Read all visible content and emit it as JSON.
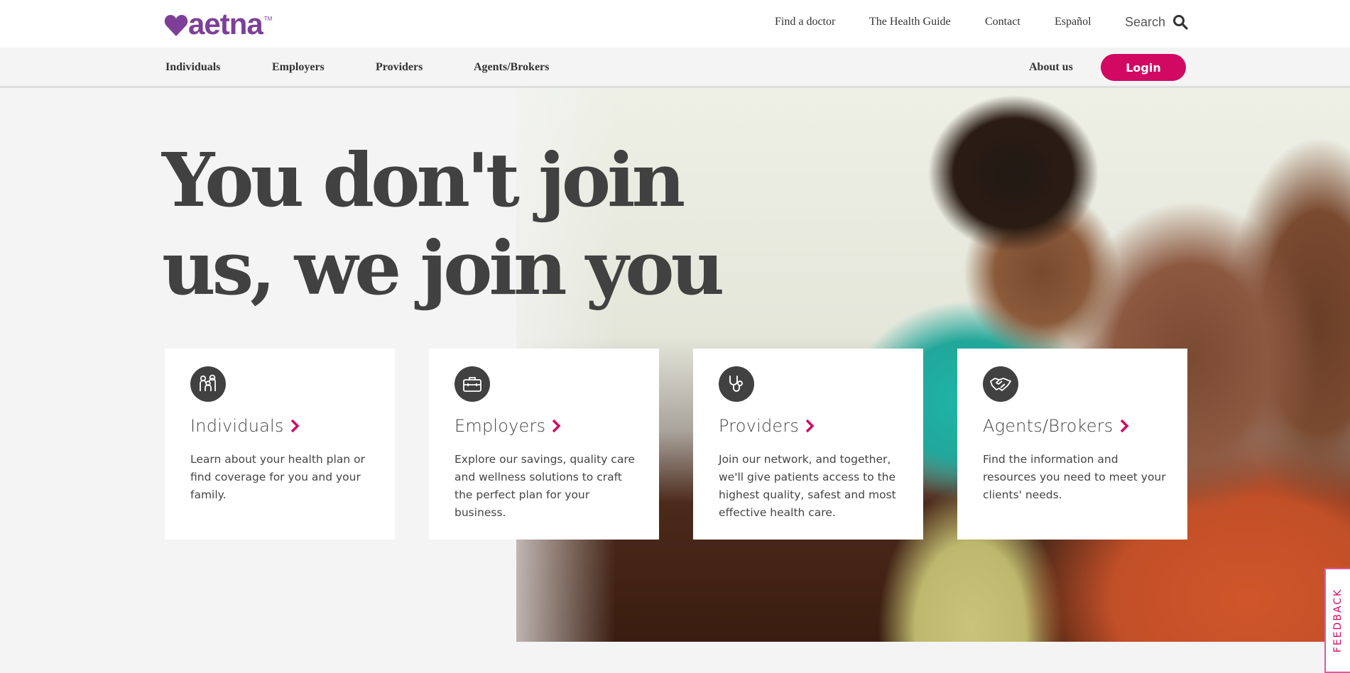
{
  "brand": {
    "name": "aetna",
    "trademark": "TM",
    "logo_icon": "heart-icon",
    "colors": {
      "purple": "#7d3f98",
      "magenta": "#d20962",
      "text_dark": "#414141"
    }
  },
  "utility_nav": {
    "items": [
      {
        "label": "Find a doctor"
      },
      {
        "label": "The Health Guide"
      },
      {
        "label": "Contact"
      },
      {
        "label": "Español"
      }
    ],
    "search": {
      "label": "Search",
      "icon": "search-icon"
    }
  },
  "main_nav": {
    "items": [
      {
        "label": "Individuals"
      },
      {
        "label": "Employers"
      },
      {
        "label": "Providers"
      },
      {
        "label": "Agents/Brokers"
      }
    ],
    "about_label": "About us",
    "login_label": "Login"
  },
  "hero": {
    "headline_line1": "You don't join",
    "headline_line2": "us, we join you",
    "image_alt": "Family with baby, grandmother and father smiling"
  },
  "cards": [
    {
      "icon": "family-icon",
      "title": "Individuals",
      "description": "Learn about your health plan or find coverage for you and your family."
    },
    {
      "icon": "briefcase-icon",
      "title": "Employers",
      "description": "Explore our savings, quality care and wellness solutions to craft the perfect plan for your business."
    },
    {
      "icon": "stethoscope-icon",
      "title": "Providers",
      "description": "Join our network, and together, we'll give patients access to the highest quality, safest and most effective health care."
    },
    {
      "icon": "handshake-icon",
      "title": "Agents/Brokers",
      "description": "Find the information and resources you need to meet your clients' needs."
    }
  ],
  "feedback": {
    "label": "FEEDBACK"
  }
}
